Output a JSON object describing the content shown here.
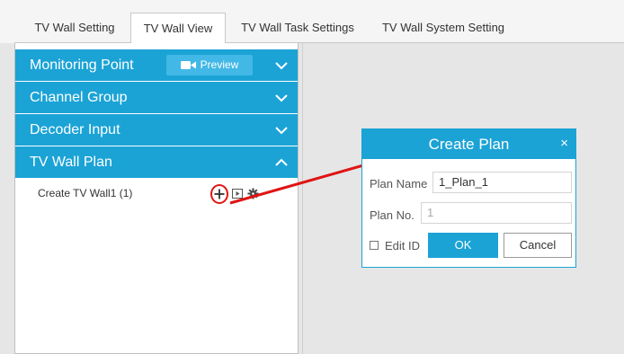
{
  "tabs": [
    "TV Wall Setting",
    "TV Wall View",
    "TV Wall Task Settings",
    "TV Wall System Setting"
  ],
  "active_tab": "TV Wall View",
  "accordion": {
    "monitoring_point": "Monitoring Point",
    "preview_label": "Preview",
    "channel_group": "Channel Group",
    "decoder_input": "Decoder Input",
    "tv_wall_plan": "TV Wall Plan"
  },
  "plan_list": {
    "item": "Create TV Wall1 (1)"
  },
  "dialog": {
    "title": "Create Plan",
    "close": "×",
    "plan_name_label": "Plan Name",
    "plan_name_value": "1_Plan_1",
    "plan_no_label": "Plan No.",
    "plan_no_value": "1",
    "edit_id_label": "Edit ID",
    "ok": "OK",
    "cancel": "Cancel"
  },
  "colors": {
    "accent": "#1ba3d6",
    "highlight": "#e01414"
  }
}
